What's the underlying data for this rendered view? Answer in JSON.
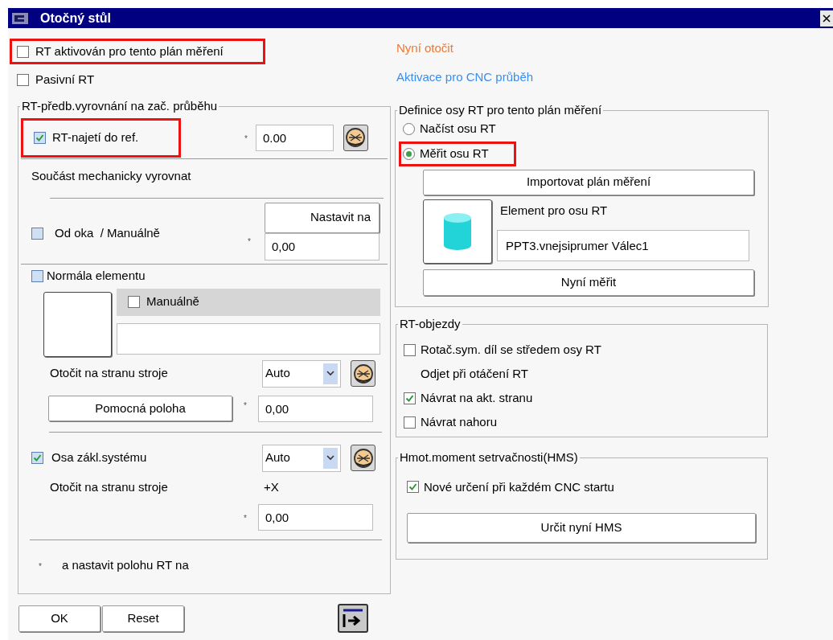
{
  "window": {
    "title": "Otočný stůl"
  },
  "left": {
    "options": [
      {
        "label": "RT aktivován pro tento plán měření",
        "checked": false,
        "highlighted": true
      },
      {
        "label": "Pasivní RT",
        "checked": false,
        "highlighted": false
      }
    ],
    "alignment_group": {
      "legend": "RT-předb.vyrovnání na zač. průběhu",
      "reference": {
        "label": "RT-najetí do ref.",
        "checked": true,
        "highlighted": true,
        "marker": "*",
        "value": "0.00"
      },
      "heading": "Součást mechanicky vyrovnat",
      "manual": {
        "label": "Od oka  / Manuálně",
        "checked": false,
        "button": "Nastavit na",
        "marker": "*",
        "value": "0,00"
      },
      "normal": {
        "label": "Normála elementu",
        "checked": false,
        "sub_checkbox": {
          "label": "Manuálně",
          "checked": false
        },
        "rotate_label": "Otočit na stranu stroje",
        "select": "Auto",
        "aux_button": "Pomocná poloha",
        "marker": "*",
        "value": "0,00"
      },
      "base_axis": {
        "label": "Osa zákl.systému",
        "checked": true,
        "select": "Auto",
        "rotate_label": "Otočit na stranu stroje",
        "side": "+X",
        "marker": "*",
        "value": "0,00"
      },
      "footnote": {
        "marker": "*",
        "text": "a nastavit polohu RT na"
      }
    },
    "buttons": [
      "OK",
      "Reset"
    ]
  },
  "right": {
    "links": [
      {
        "text": "Nyní otočit",
        "color": "#f07830"
      },
      {
        "text": "Aktivace pro CNC průběh",
        "color": "#3a8ef0"
      }
    ],
    "axis_group": {
      "legend": "Definice osy RT pro tento plán měření",
      "radios": [
        {
          "label": "Načíst osu RT",
          "selected": false,
          "highlighted": false
        },
        {
          "label": "Měřit osu RT",
          "selected": true,
          "highlighted": true
        }
      ],
      "import_button": "Importovat plán měření",
      "element_label": "Element pro osu RT",
      "element_value": "PPT3.vnejsiprumer Válec1",
      "measure_button": "Nyní měřit"
    },
    "bypass_group": {
      "legend": "RT-objezdy",
      "items": [
        {
          "kind": "checkbox",
          "label": "Rotač.sym. díl se středem osy RT",
          "checked": false
        },
        {
          "kind": "text",
          "label": "Odjet při otáčení RT"
        },
        {
          "kind": "checkbox",
          "label": "Návrat na akt. stranu",
          "checked": true
        },
        {
          "kind": "checkbox",
          "label": "Návrat nahoru",
          "checked": false
        }
      ]
    },
    "hms_group": {
      "legend": "Hmot.moment setrvačnosti(HMS)",
      "option": {
        "label": "Nové určení při každém CNC startu",
        "checked": true
      },
      "button": "Určit nyní HMS"
    }
  }
}
